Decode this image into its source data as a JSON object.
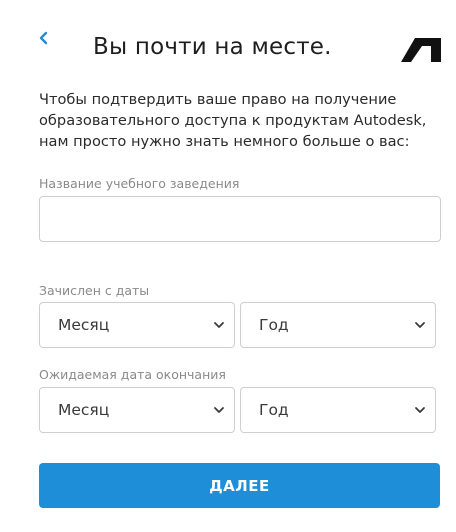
{
  "header": {
    "back_icon": "chevron-left-icon",
    "title": "Вы почти на месте.",
    "logo_icon": "autodesk-logo-icon",
    "accent_color": "#1e8ed8"
  },
  "intro": {
    "line1": "Чтобы подтвердить ваше право на получение",
    "line2": "образовательного доступа к продуктам Autodesk,",
    "line3": "нам просто нужно знать немного больше о вас:"
  },
  "form": {
    "school": {
      "label": "Название учебного заведения",
      "value": "",
      "placeholder": ""
    },
    "enrolled": {
      "label": "Зачислен с даты",
      "month": "Месяц",
      "year": "Год"
    },
    "graduation": {
      "label": "Ожидаемая дата окончания",
      "month": "Месяц",
      "year": "Год"
    },
    "chevron_icon": "chevron-down-icon"
  },
  "actions": {
    "next_label": "ДАЛЕЕ"
  }
}
